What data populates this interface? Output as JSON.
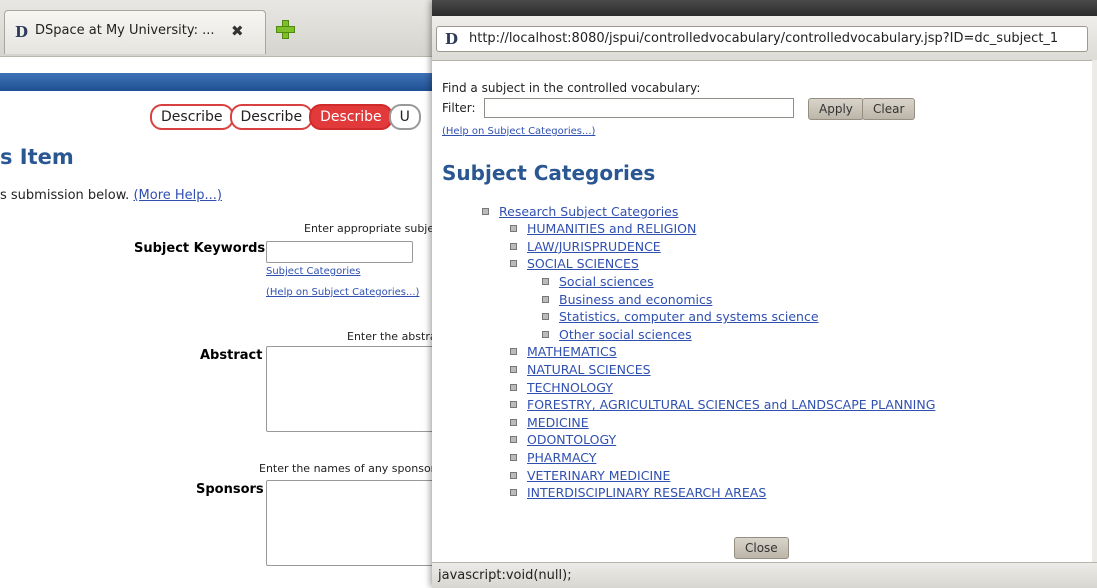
{
  "browser": {
    "tab_title": "DSpace at My University: ...",
    "tab_favicon": "D",
    "tab_close_icon": "close-icon",
    "new_tab_icon": "plus-icon"
  },
  "progress": {
    "steps": [
      "Describe",
      "Describe",
      "Describe",
      "U"
    ]
  },
  "form": {
    "heading": "s Item",
    "intro_text": "s submission below. ",
    "intro_link": "(More Help...)",
    "subject_hint": "Enter appropriate subject",
    "subject_label": "Subject Keywords",
    "subject_categories_link": "Subject Categories",
    "subject_help_link": "(Help on Subject Categories...)",
    "abstract_hint": "Enter the abstra",
    "abstract_label": "Abstract",
    "sponsors_hint": "Enter the names of any sponsors a",
    "sponsors_label": "Sponsors"
  },
  "popup": {
    "url": "http://localhost:8080/jspui/controlledvocabulary/controlledvocabulary.jsp?ID=dc_subject_1",
    "url_favicon": "D",
    "find_label": "Find a subject in the controlled vocabulary:",
    "filter_label": "Filter:",
    "filter_value": "",
    "apply_label": "Apply",
    "clear_label": "Clear",
    "help_link": "(Help on Subject Categories...)",
    "heading": "Subject Categories",
    "tree": [
      {
        "label": "Research Subject Categories",
        "level": 0
      },
      {
        "label": "HUMANITIES and RELIGION",
        "level": 1
      },
      {
        "label": "LAW/JURISPRUDENCE",
        "level": 1
      },
      {
        "label": "SOCIAL SCIENCES",
        "level": 1
      },
      {
        "label": "Social sciences",
        "level": 2
      },
      {
        "label": "Business and economics",
        "level": 2
      },
      {
        "label": "Statistics, computer and systems science",
        "level": 2
      },
      {
        "label": "Other social sciences",
        "level": 2
      },
      {
        "label": "MATHEMATICS",
        "level": 1
      },
      {
        "label": "NATURAL SCIENCES",
        "level": 1
      },
      {
        "label": "TECHNOLOGY",
        "level": 1
      },
      {
        "label": "FORESTRY, AGRICULTURAL SCIENCES and LANDSCAPE PLANNING",
        "level": 1
      },
      {
        "label": "MEDICINE",
        "level": 1
      },
      {
        "label": "ODONTOLOGY",
        "level": 1
      },
      {
        "label": "PHARMACY",
        "level": 1
      },
      {
        "label": "VETERINARY MEDICINE",
        "level": 1
      },
      {
        "label": "INTERDISCIPLINARY RESEARCH AREAS",
        "level": 1
      }
    ],
    "close_label": "Close",
    "status_text": "javascript:void(null);"
  }
}
